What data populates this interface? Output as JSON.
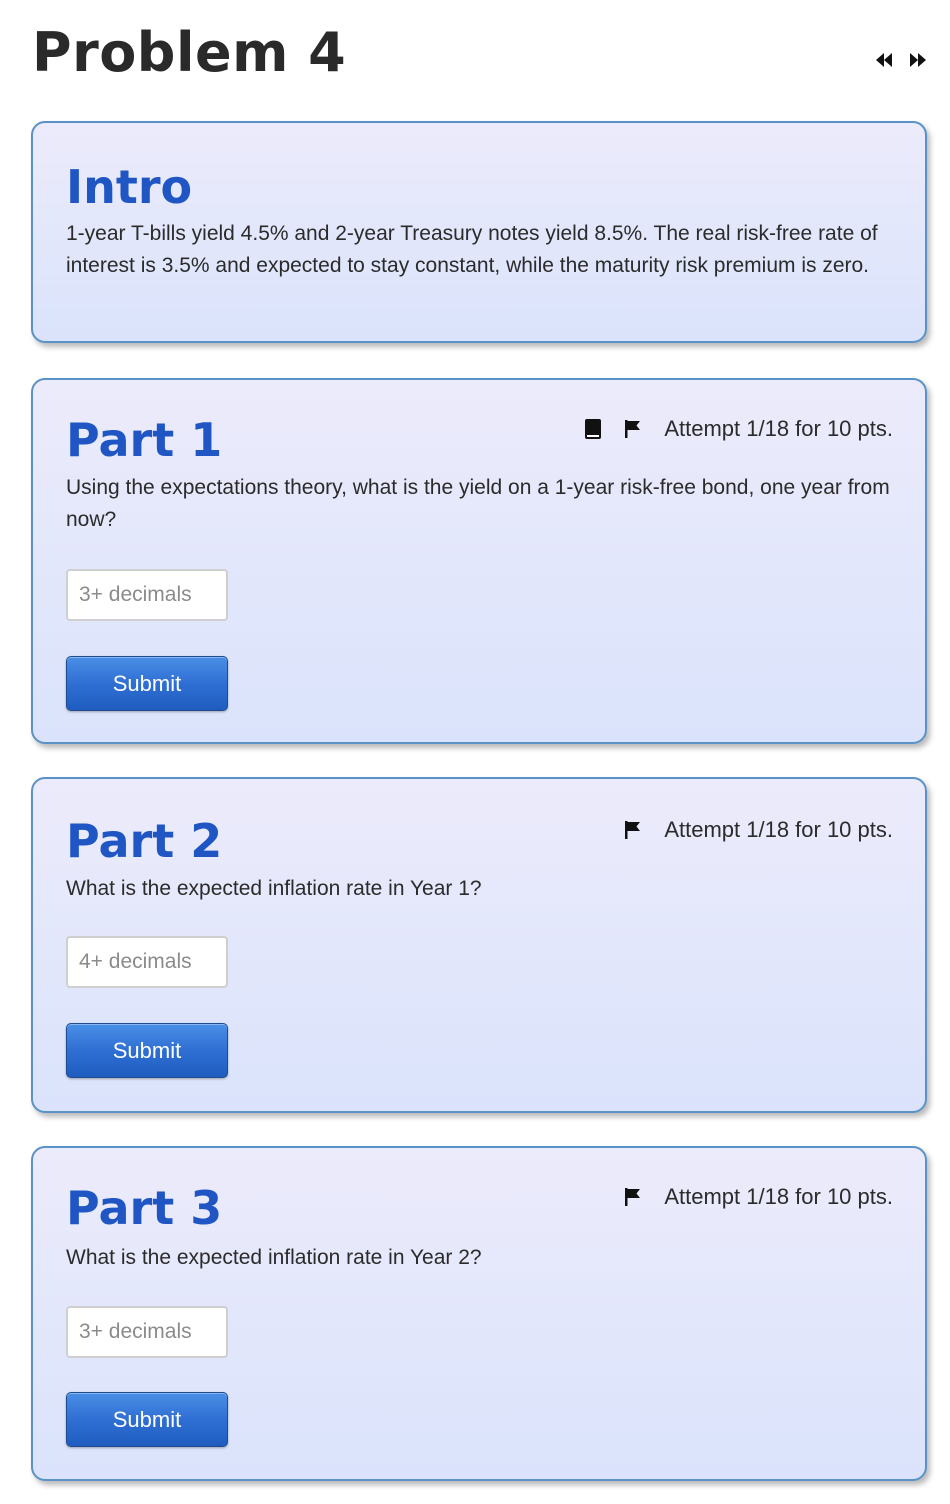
{
  "header": {
    "title": "Problem 4",
    "prev_icon": "double-chevron-left-icon",
    "next_icon": "double-chevron-right-icon"
  },
  "intro": {
    "heading": "Intro",
    "text": "1-year T-bills yield 4.5% and 2-year Treasury notes yield 8.5%. The real risk-free rate of interest is 3.5% and expected to stay constant, while the maturity risk premium is zero."
  },
  "parts": [
    {
      "heading": "Part 1",
      "question": "Using the expectations theory, what is the yield on a 1-year risk-free bond, one year from now?",
      "attempt": "Attempt 1/18 for 10 pts.",
      "placeholder": "3+ decimals",
      "value": "",
      "submit_label": "Submit",
      "icons": [
        "book-icon",
        "flag-icon"
      ]
    },
    {
      "heading": "Part 2",
      "question": "What is the expected inflation rate in Year 1?",
      "attempt": "Attempt 1/18 for 10 pts.",
      "placeholder": "4+ decimals",
      "value": "",
      "submit_label": "Submit",
      "icons": [
        "flag-icon"
      ]
    },
    {
      "heading": "Part 3",
      "question": "What is the expected inflation rate in Year 2?",
      "attempt": "Attempt 1/18 for 10 pts.",
      "placeholder": "3+ decimals",
      "value": "",
      "submit_label": "Submit",
      "icons": [
        "flag-icon"
      ]
    }
  ],
  "colors": {
    "heading": "#1f56c4",
    "card_border": "#5a92c7",
    "button": "#2f6fd3"
  }
}
